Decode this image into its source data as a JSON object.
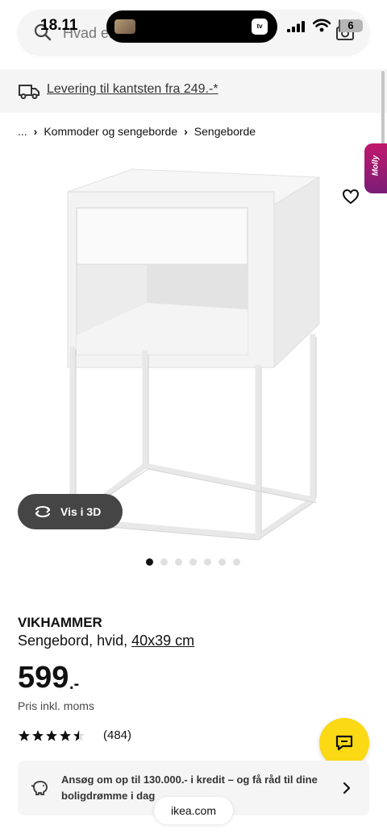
{
  "status_bar": {
    "time": "18.11",
    "battery": "6",
    "battery_level": 0.06,
    "island_app_icon": "apple-tv-icon",
    "island_app_label": "tv"
  },
  "search": {
    "placeholder": "Hvad er",
    "search_icon": "search-icon",
    "camera_icon": "camera-icon"
  },
  "delivery": {
    "icon": "truck-icon",
    "text": "Levering til kantsten fra 249.-*"
  },
  "breadcrumb": {
    "items": [
      "...",
      "Kommoder og sengeborde",
      "Sengeborde"
    ],
    "separator": "›"
  },
  "gallery": {
    "view_3d_label": "Vis i 3D",
    "molly_label": "Molly",
    "dots_total": 7,
    "active_dot": 0
  },
  "product": {
    "name": "VIKHAMMER",
    "description": "Sengebord, hvid,",
    "size": "40x39 cm",
    "price": "599",
    "price_suffix": ".-",
    "price_note": "Pris inkl. moms",
    "rating": 4.5,
    "rating_max": 5,
    "review_count": "(484)"
  },
  "credit": {
    "text": "Ansøg om op til 130.000.- i kredit – og få råd til dine boligdrømme i dag"
  },
  "browser": {
    "url": "ikea.com"
  },
  "colors": {
    "accent_yellow": "#fbd914",
    "molly_magenta": "#c0186b",
    "dark_button": "#454545",
    "banner_grey": "#f5f5f5"
  }
}
